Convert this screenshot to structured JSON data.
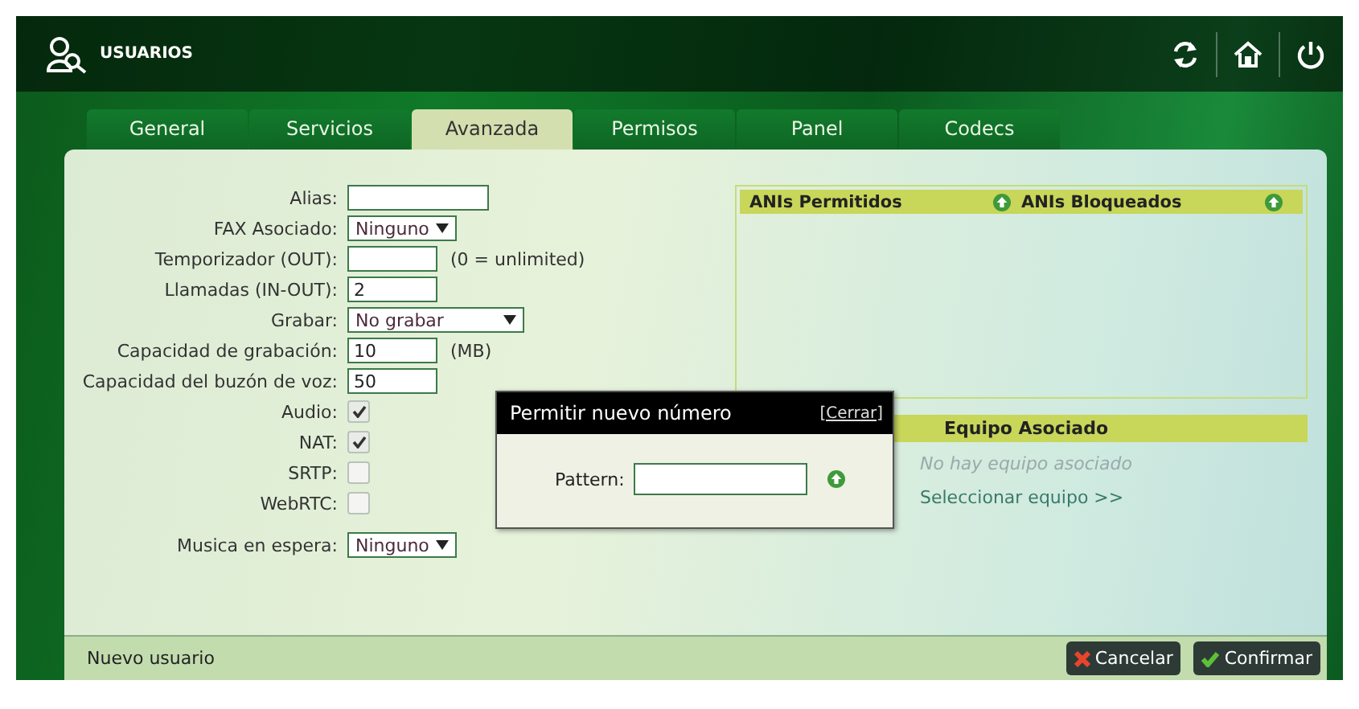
{
  "header": {
    "title": "USUARIOS"
  },
  "tabs": [
    {
      "label": "General",
      "selected": false
    },
    {
      "label": "Servicios",
      "selected": false
    },
    {
      "label": "Avanzada",
      "selected": true
    },
    {
      "label": "Permisos",
      "selected": false
    },
    {
      "label": "Panel",
      "selected": false
    },
    {
      "label": "Codecs",
      "selected": false
    }
  ],
  "form": {
    "fields": [
      {
        "label": "Alias:",
        "kind": "text"
      },
      {
        "label": "FAX Asociado:",
        "kind": "select",
        "value": "Ninguno"
      },
      {
        "label": "Temporizador (OUT):",
        "kind": "text",
        "note": "(0 = unlimited)"
      },
      {
        "label": "Llamadas (IN-OUT):",
        "kind": "text",
        "value": "2"
      },
      {
        "label": "Grabar:",
        "kind": "select",
        "value": "No grabar"
      },
      {
        "label": "Capacidad de grabación:",
        "kind": "text",
        "value": "10",
        "note": "(MB)"
      },
      {
        "label": "Capacidad del buzón de voz:",
        "kind": "text",
        "value": "50"
      },
      {
        "label": "Audio:",
        "kind": "checkbox",
        "checked": true
      },
      {
        "label": "NAT:",
        "kind": "checkbox",
        "checked": true
      },
      {
        "label": "SRTP:",
        "kind": "checkbox",
        "checked": false
      },
      {
        "label": "WebRTC:",
        "kind": "checkbox",
        "checked": false
      }
    ],
    "hold_music": {
      "label": "Musica en espera:",
      "value": "Ninguno"
    }
  },
  "anis": {
    "allowed_title": "ANIs Permitidos",
    "blocked_title": "ANIs Bloqueados"
  },
  "equipment": {
    "title": "Equipo Asociado",
    "empty_text": "No hay equipo asociado",
    "link": "Seleccionar equipo >>"
  },
  "dialog": {
    "title": "Permitir nuevo número",
    "close": "[Cerrar]",
    "field_label": "Pattern:"
  },
  "footer": {
    "status": "Nuevo usuario",
    "buttons": [
      {
        "label": "Cancelar",
        "kind": "cancel"
      },
      {
        "label": "Confirmar",
        "kind": "confirm"
      }
    ]
  }
}
